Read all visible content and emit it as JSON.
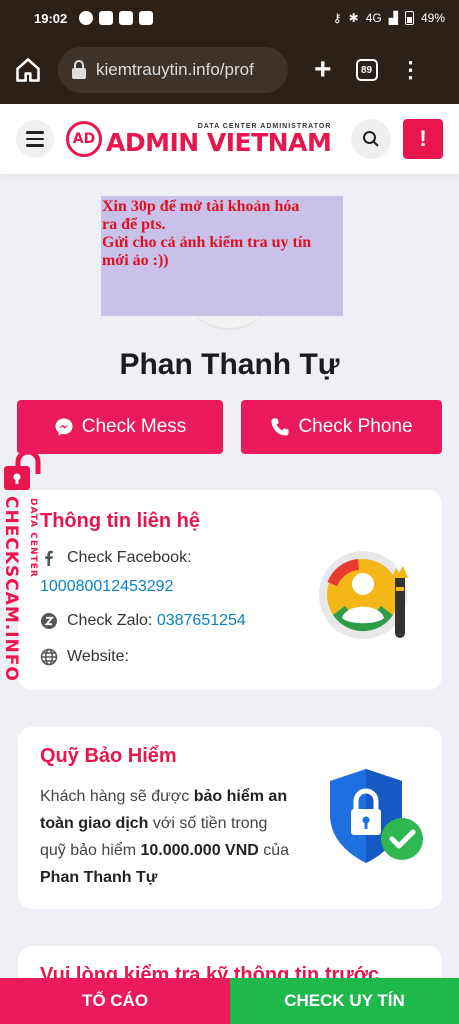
{
  "status_bar": {
    "time": "19:02",
    "network": "4G",
    "battery": "49%"
  },
  "browser": {
    "url": "kiemtrauytin.info/prof",
    "tab_count": "89"
  },
  "header": {
    "logo_small": "DATA CENTER ADMINISTRATOR",
    "logo_big": "ADMIN VIETNAM",
    "logo_mark": "AD",
    "alert_label": "!"
  },
  "note_overlay": "Xin 30p để mở tài khoản hóa\nra để pts.\nGửi cho cả ảnh kiểm tra uy tín\nmới ảo :))",
  "profile": {
    "name": "Phan Thanh Tự"
  },
  "actions": {
    "mess_label": "Check Mess",
    "phone_label": "Check Phone"
  },
  "watermark": {
    "big": "CHECKSCAM.INFO",
    "small": "DATA CENTER"
  },
  "contact": {
    "title": "Thông tin liên hệ",
    "facebook_label": "Check Facebook:",
    "facebook_id": "100080012453292",
    "zalo_label": "Check Zalo:",
    "zalo_value": "0387651254",
    "website_label": "Website:"
  },
  "insurance": {
    "title": "Quỹ Bảo Hiểm",
    "text_1": "Khách hàng sẽ được ",
    "bold_1": "bảo hiểm an toàn giao dịch",
    "text_2": " với số tiền trong quỹ bảo hiểm ",
    "bold_2": "10.000.000 VND",
    "text_3": " của ",
    "bold_3": "Phan Thanh Tự"
  },
  "partial_card": {
    "title": "Vui lòng kiểm tra kỹ thông tin trước"
  },
  "bottom_bar": {
    "report_label": "TỐ CÁO",
    "check_label": "CHECK UY TÍN"
  },
  "colors": {
    "brand": "#e9164d",
    "link": "#0a84c6",
    "success": "#1eb84b"
  }
}
